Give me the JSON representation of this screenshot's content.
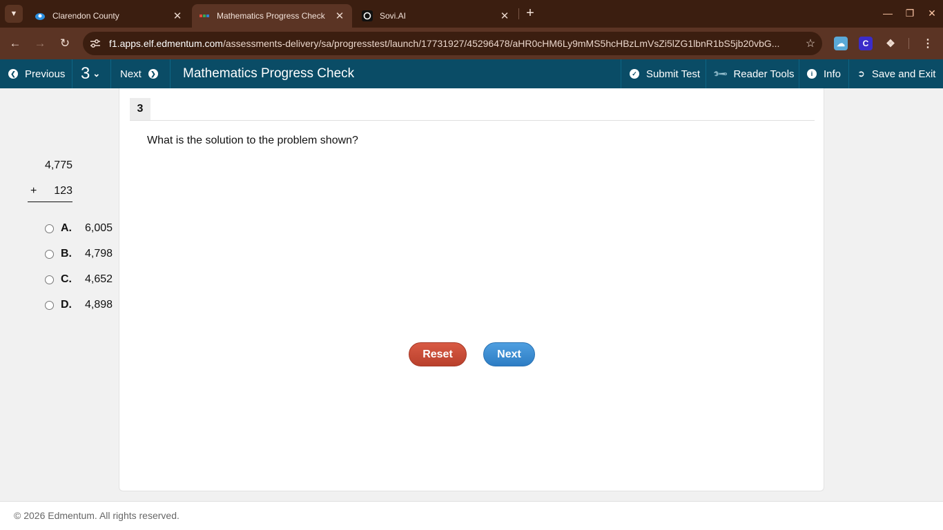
{
  "browser": {
    "tabs": [
      {
        "title": "Clarendon County",
        "favicon": "cloud-icon",
        "active": false
      },
      {
        "title": "Mathematics Progress Check",
        "favicon": "edmentum-icon",
        "active": true
      },
      {
        "title": "Sovi.AI",
        "favicon": "sovi-icon",
        "active": false
      }
    ],
    "url_host": "f1.apps.elf.edmentum.com",
    "url_path": "/assessments-delivery/sa/progresstest/launch/17731927/45296478/aHR0cHM6Ly9mMS5hcHBzLmVsZi5lZG1lbnR1bS5jb20vbG..."
  },
  "appbar": {
    "previous_label": "Previous",
    "question_number": "3",
    "next_label": "Next",
    "title": "Mathematics Progress Check",
    "submit_label": "Submit Test",
    "reader_tools_label": "Reader Tools",
    "info_label": "Info",
    "save_exit_label": "Save and Exit",
    "color": "#0a4c66"
  },
  "question": {
    "number": "3",
    "prompt": "What is the solution to the problem shown?",
    "problem": {
      "addend1": "4,775",
      "operator": "+",
      "addend2": "123"
    },
    "choices": [
      {
        "letter": "A.",
        "text": "6,005"
      },
      {
        "letter": "B.",
        "text": "4,798"
      },
      {
        "letter": "C.",
        "text": "4,652"
      },
      {
        "letter": "D.",
        "text": "4,898"
      }
    ],
    "reset_label": "Reset",
    "next_label": "Next"
  },
  "footer": {
    "copyright": "© 2026 Edmentum. All rights reserved."
  }
}
